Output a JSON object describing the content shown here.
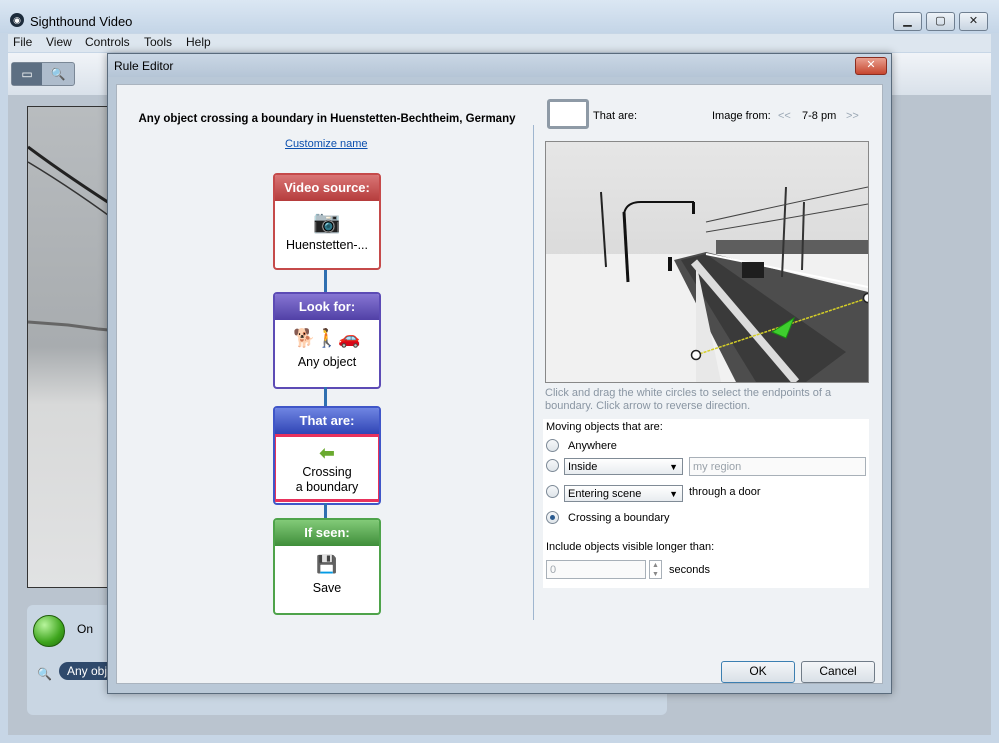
{
  "app": {
    "title": "Sighthound Video",
    "logo_icon": "sighthound-logo-icon",
    "menu": [
      "File",
      "View",
      "Controls",
      "Tools",
      "Help"
    ],
    "window_buttons": {
      "minimize": "▁",
      "maximize": "▢",
      "close": "✕"
    }
  },
  "main": {
    "status_label": "On",
    "rule_chip": "Any obje"
  },
  "dialog": {
    "title": "Rule Editor",
    "close": "✕",
    "rule_title": "Any object crossing a boundary in Huenstetten-Bechtheim, Germany",
    "customize_link": "Customize name",
    "flow": [
      {
        "head": "Video source:",
        "body": "Huenstetten-...",
        "icon": "camera-icon",
        "color": "#c54a4a"
      },
      {
        "head": "Look for:",
        "body": "Any object",
        "icon": "people-animal-car-icon",
        "color": "#5c4bb5"
      },
      {
        "head": "That are:",
        "body_line1": "Crossing",
        "body_line2": "a boundary",
        "icon": "arrow-left-icon",
        "color": "#3f56c8"
      },
      {
        "head": "If seen:",
        "body": "Save",
        "icon": "floppy-disk-icon",
        "color": "#4ea34a"
      }
    ],
    "that_are_label": "That are:",
    "image_from_label": "Image from:",
    "prev_nav": "<<",
    "time_range": "7-8 pm",
    "next_nav": ">>",
    "hint": "Click and drag the white circles to select the endpoints of a boundary. Click arrow to reverse direction.",
    "options": {
      "heading": "Moving objects that are:",
      "anywhere": "Anywhere",
      "inside_select": "Inside",
      "region_placeholder": "my region",
      "entering_select": "Entering scene",
      "through_door": "through a door",
      "crossing": "Crossing a boundary",
      "visible_longer": "Include objects visible longer than:",
      "seconds_value": "0",
      "seconds_label": "seconds",
      "selected": "crossing"
    },
    "ok": "OK",
    "cancel": "Cancel"
  }
}
